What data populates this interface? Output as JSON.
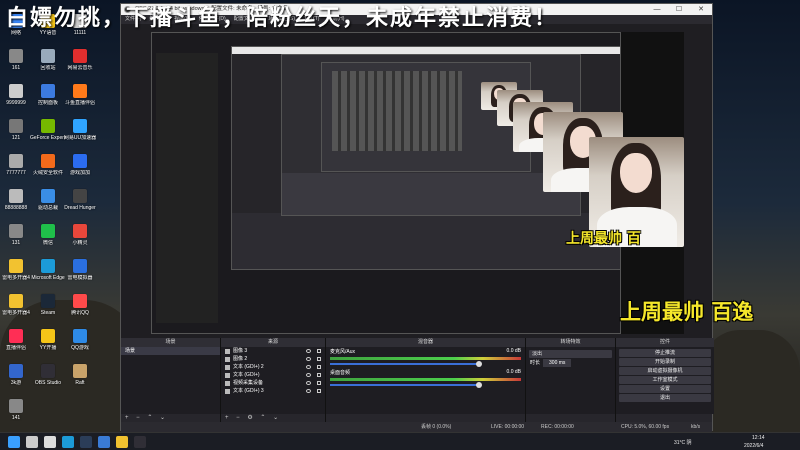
{
  "banner": {
    "text": "白嫖勿挑，下播斗鱼，陪粉丝天，未成年禁止消费！"
  },
  "desktop_icons": [
    {
      "label": "网络",
      "color": "#3d8bfd"
    },
    {
      "label": "YY语音",
      "color": "#f5c518"
    },
    {
      "label": "11111",
      "color": "#cccccc"
    },
    {
      "label": "161",
      "color": "#888888"
    },
    {
      "label": "回收站",
      "color": "#9ab"
    },
    {
      "label": "网易云音乐",
      "color": "#e02e2e"
    },
    {
      "label": "9999999",
      "color": "#cccccc"
    },
    {
      "label": "控制面板",
      "color": "#3c7be0"
    },
    {
      "label": "斗鱼直播伴侣",
      "color": "#ff7a1a"
    },
    {
      "label": "121",
      "color": "#777777"
    },
    {
      "label": "GeForce Experience",
      "color": "#76b900"
    },
    {
      "label": "网易UU加速器",
      "color": "#2fa4ff"
    },
    {
      "label": "7777777",
      "color": "#aaaaaa"
    },
    {
      "label": "火绒安全软件",
      "color": "#f26a1b"
    },
    {
      "label": "游戏加加",
      "color": "#2b6cf0"
    },
    {
      "label": "88888888",
      "color": "#bbbbbb"
    },
    {
      "label": "驱动总裁",
      "color": "#3a8ee6"
    },
    {
      "label": "Dread Hunger",
      "color": "#444444"
    },
    {
      "label": "131",
      "color": "#888888"
    },
    {
      "label": "微信",
      "color": "#1fbf4a"
    },
    {
      "label": "小精灵",
      "color": "#e8473b"
    },
    {
      "label": "雷电多开器4",
      "color": "#f2c230"
    },
    {
      "label": "Microsoft Edge",
      "color": "#1c9bd8"
    },
    {
      "label": "雷电模拟器",
      "color": "#2a6fe0"
    },
    {
      "label": "雷电多开器4",
      "color": "#f2c230"
    },
    {
      "label": "Steam",
      "color": "#1b2838"
    },
    {
      "label": "腾讯QQ",
      "color": "#ff4a4a"
    },
    {
      "label": "直播伴侣",
      "color": "#ff2e55"
    },
    {
      "label": "YY开播",
      "color": "#f5c518"
    },
    {
      "label": "QQ游戏",
      "color": "#2e8ae6"
    },
    {
      "label": "3k游",
      "color": "#3366cc"
    },
    {
      "label": "OBS Studio",
      "color": "#302e36"
    },
    {
      "label": "Raft",
      "color": "#c9a36a"
    },
    {
      "label": "141",
      "color": "#888888"
    }
  ],
  "window": {
    "title": "OBS 27.1.1 (64 bit, windows) - 配置文件: 未命名 - 场景: 未命名",
    "menu": [
      "文件(F)",
      "编辑(E)",
      "视图(V)",
      "停靠部件(D)",
      "配置文件(P)",
      "场景集合(S)",
      "工具(T)",
      "帮助(H)"
    ],
    "minimize": "—",
    "maximize": "☐",
    "close": "✕"
  },
  "preview": {
    "caption_main": "上周最帅 百逸",
    "caption_small": "上周最帅 百"
  },
  "docks": {
    "scenes": {
      "header": "场景",
      "items": [
        "场景"
      ],
      "footer": "+ − ⌃ ⌄"
    },
    "sources": {
      "header": "来源",
      "items": [
        {
          "name": "图像 3",
          "type": "image"
        },
        {
          "name": "图像 2",
          "type": "image"
        },
        {
          "name": "文本 (GDI+) 2",
          "type": "text"
        },
        {
          "name": "文本 (GDI+)",
          "type": "text"
        },
        {
          "name": "视频采集设备",
          "type": "camera"
        },
        {
          "name": "文本 (GDI+) 3",
          "type": "text"
        }
      ],
      "footer": "+ − ⚙ ⌃ ⌄"
    },
    "mixer": {
      "header": "混音器",
      "tracks": [
        {
          "name": "麦克风/Aux",
          "db": "0.0 dB"
        },
        {
          "name": "桌面音频",
          "db": "0.0 dB"
        }
      ]
    },
    "transitions": {
      "header": "转场特效",
      "type": "淡出",
      "duration_label": "时长",
      "duration_value": "300 ms"
    },
    "controls": {
      "header": "控件",
      "buttons": [
        "停止推流",
        "开始录制",
        "启动虚拟摄像机",
        "工作室模式",
        "设置",
        "退出"
      ]
    }
  },
  "statusbar": {
    "dropped": "丢帧 0 (0.0%)",
    "live": "LIVE: 00:00:00",
    "rec": "REC: 00:00:00",
    "cpu": "CPU: 5.0%, 60.00 fps",
    "bitrate": "kb/s"
  },
  "taskbar": {
    "weather": "31°C 阴",
    "time": "12:14",
    "date": "2022/6/4",
    "apps": [
      {
        "name": "start-icon",
        "color": "#3aa0ff"
      },
      {
        "name": "search-icon",
        "color": "#cccccc"
      },
      {
        "name": "task-view-icon",
        "color": "#dddddd"
      },
      {
        "name": "edge-icon",
        "color": "#1c9bd8"
      },
      {
        "name": "steam-icon",
        "color": "#2b3d58"
      },
      {
        "name": "game-icon",
        "color": "#3a7bd5"
      },
      {
        "name": "folder-icon",
        "color": "#f2c230"
      },
      {
        "name": "obs-icon",
        "color": "#302e36"
      }
    ]
  }
}
